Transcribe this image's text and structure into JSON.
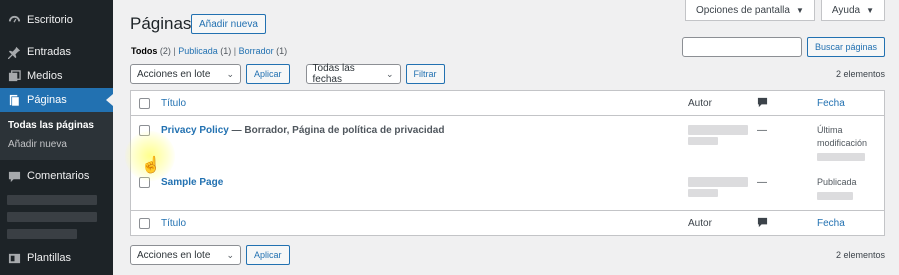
{
  "sidebar": {
    "items": [
      {
        "label": "Escritorio",
        "icon": "dashboard-icon"
      },
      {
        "label": "Entradas",
        "icon": "pin-icon"
      },
      {
        "label": "Medios",
        "icon": "media-icon"
      },
      {
        "label": "Páginas",
        "icon": "pages-icon"
      },
      {
        "label": "Comentarios",
        "icon": "comments-icon"
      },
      {
        "label": "Plantillas",
        "icon": "templates-icon"
      }
    ],
    "submenu": {
      "all": "Todas las páginas",
      "add": "Añadir nueva"
    }
  },
  "screen_options": {
    "label": "Opciones de pantalla"
  },
  "help": {
    "label": "Ayuda"
  },
  "header": {
    "title": "Páginas",
    "add_new": "Añadir nueva"
  },
  "filters": {
    "all": "Todos",
    "all_count": "(2)",
    "published": "Publicada",
    "published_count": "(1)",
    "draft": "Borrador",
    "draft_count": "(1)",
    "separator": "|"
  },
  "search": {
    "button": "Buscar páginas",
    "value": ""
  },
  "tablenav_top": {
    "bulk": "Acciones en lote",
    "apply": "Aplicar",
    "dates": "Todas las fechas",
    "filter": "Filtrar",
    "count": "2 elementos"
  },
  "table": {
    "columns": {
      "title": "Título",
      "author": "Autor",
      "date": "Fecha"
    },
    "rows": [
      {
        "title": "Privacy Policy",
        "state": " — Borrador, Página de política de privacidad",
        "author_dash": "—",
        "date_line1": "Última",
        "date_line2": "modificación"
      },
      {
        "title": "Sample Page",
        "state": "",
        "author_dash": "—",
        "date_line1": "Publicada",
        "date_line2": ""
      }
    ]
  },
  "tablenav_bottom": {
    "bulk": "Acciones en lote",
    "apply": "Aplicar",
    "count": "2 elementos"
  },
  "colors": {
    "accent": "#2271b1",
    "sidebar": "#1d2327",
    "active": "#2271b1"
  }
}
